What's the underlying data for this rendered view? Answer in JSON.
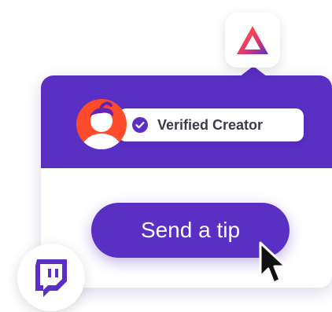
{
  "brand": {
    "icon": "brave-triangle-logo",
    "accent": "#5a2fc4"
  },
  "creator": {
    "avatar_icon": "creator-avatar",
    "verified_icon": "check-circle-icon",
    "verified_label": "Verified Creator"
  },
  "tip": {
    "button_label": "Send a tip"
  },
  "platform": {
    "icon": "twitch-icon"
  }
}
